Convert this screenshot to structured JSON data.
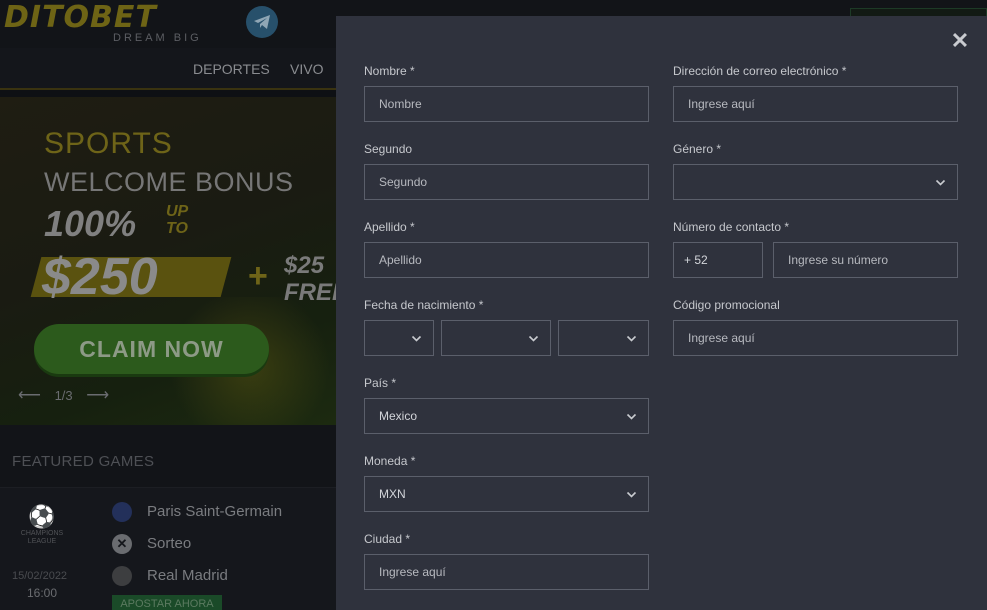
{
  "background": {
    "logo": "DITOBET",
    "tagline": "DREAM BIG",
    "nav": [
      "DEPORTES",
      "VIVO"
    ],
    "banner": {
      "sports": "SPORTS",
      "welcome_bonus": "WELCOME BONUS",
      "percent": "100%",
      "up_to": "UP TO",
      "amount": "$250",
      "plus": "+",
      "extra_line1": "$25",
      "extra_line2": "FREE",
      "claim_label": "CLAIM NOW",
      "slide_indicator": "1/3",
      "prev_arrow": "⟵",
      "next_arrow": "⟶"
    },
    "featured": {
      "title": "FEATURED GAMES",
      "competition_line1": "CHAMPIONS",
      "competition_line2": "LEAGUE",
      "date": "15/02/2022",
      "time": "16:00",
      "teams": [
        "Paris Saint-Germain",
        "Sorteo",
        "Real Madrid"
      ],
      "bet_label": "APOSTAR AHORA"
    }
  },
  "modal": {
    "close_symbol": "✕",
    "fields": {
      "nombre": {
        "label": "Nombre *",
        "placeholder": "Nombre"
      },
      "segundo": {
        "label": "Segundo",
        "placeholder": "Segundo"
      },
      "apellido": {
        "label": "Apellido *",
        "placeholder": "Apellido"
      },
      "fecha": {
        "label": "Fecha de nacimiento *"
      },
      "pais": {
        "label": "País *",
        "value": "Mexico"
      },
      "moneda": {
        "label": "Moneda *",
        "value": "MXN"
      },
      "ciudad": {
        "label": "Ciudad *",
        "placeholder": "Ingrese aquí"
      },
      "email": {
        "label": "Dirección de correo electrónico *",
        "placeholder": "Ingrese aquí"
      },
      "genero": {
        "label": "Género *",
        "value": ""
      },
      "contacto": {
        "label": "Número de contacto *",
        "prefix": "+ 52",
        "placeholder": "Ingrese su número"
      },
      "promo": {
        "label": "Código promocional",
        "placeholder": "Ingrese aquí"
      }
    }
  },
  "colors": {
    "modal_bg": "#2f323d",
    "input_border": "#5b5f6b",
    "brand_yellow": "#6e6415",
    "bet_green": "#1a4a28"
  }
}
